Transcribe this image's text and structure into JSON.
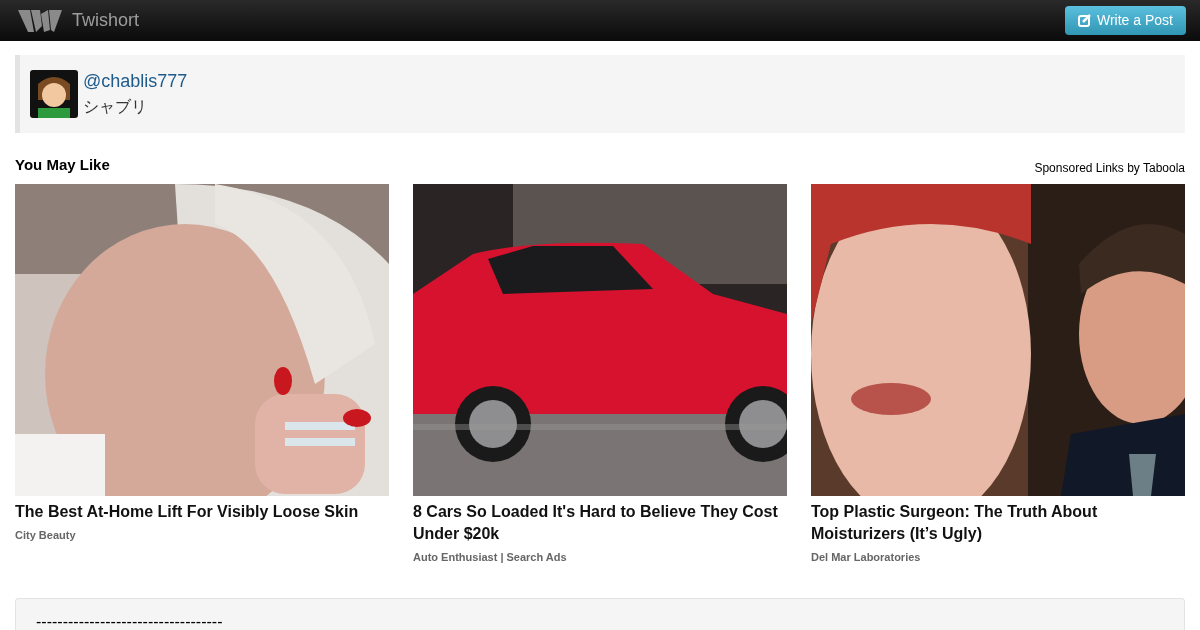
{
  "navbar": {
    "brand": "Twishort",
    "button": "Write a Post"
  },
  "profile": {
    "handle": "@chablis777",
    "name": "シャブリ"
  },
  "recommendations": {
    "heading": "You May Like",
    "sponsor": "Sponsored Links by Taboola",
    "items": [
      {
        "title": "The Best At-Home Lift For Visibly Loose Skin",
        "source": "City Beauty"
      },
      {
        "title": "8 Cars So Loaded It's Hard to Believe They Cost Under $20k",
        "source": "Auto Enthusiast | Search Ads"
      },
      {
        "kind": "figure2",
        "title": "Top Plastic Surgeon: The Truth About Moisturizers (It’s Ugly)",
        "source": "Del Mar Laboratories"
      }
    ]
  },
  "post": {
    "text": "-----------------------------------"
  }
}
